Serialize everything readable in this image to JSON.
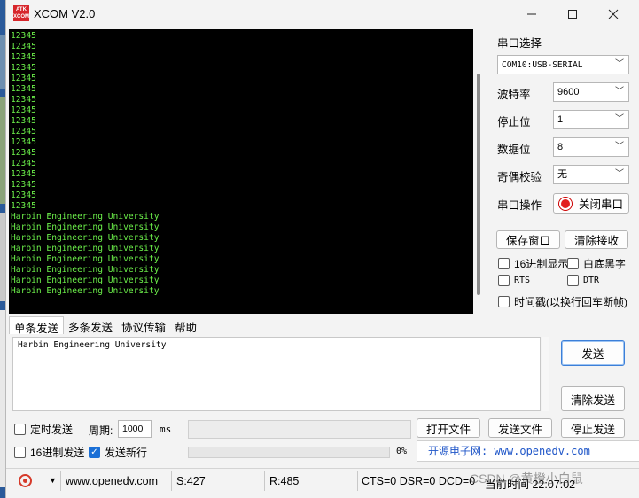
{
  "window": {
    "title": "XCOM V2.0",
    "icon_label": "ATK XCOM"
  },
  "receive": {
    "lines": [
      "12345",
      "12345",
      "12345",
      "12345",
      "12345",
      "12345",
      "12345",
      "12345",
      "12345",
      "12345",
      "12345",
      "12345",
      "12345",
      "12345",
      "12345",
      "12345",
      "12345",
      "Harbin Engineering University",
      "Harbin Engineering University",
      "Harbin Engineering University",
      "Harbin Engineering University",
      "Harbin Engineering University",
      "Harbin Engineering University",
      "Harbin Engineering University",
      "Harbin Engineering University"
    ]
  },
  "settings": {
    "port_select_label": "串口选择",
    "port_value": "COM10:USB-SERIAL",
    "baud_label": "波特率",
    "baud_value": "9600",
    "stop_label": "停止位",
    "stop_value": "1",
    "data_label": "数据位",
    "data_value": "8",
    "parity_label": "奇偶校验",
    "parity_value": "无",
    "port_op_label": "串口操作",
    "close_port_button": "关闭串口",
    "save_window_button": "保存窗口",
    "clear_receive_button": "清除接收",
    "hex_display": "16进制显示",
    "white_bg": "白底黑字",
    "rts": "RTS",
    "dtr": "DTR",
    "timestamp": "时间戳(以换行回车断帧)"
  },
  "tabs": [
    "单条发送",
    "多条发送",
    "协议传输",
    "帮助"
  ],
  "send": {
    "text": "Harbin Engineering University",
    "send_button": "发送",
    "clear_send_button": "清除发送",
    "timed_send": "定时发送",
    "period_label": "周期:",
    "period_value": "1000",
    "period_unit": "ms",
    "open_file_button": "打开文件",
    "send_file_button": "发送文件",
    "stop_send_button": "停止发送",
    "hex_send": "16进制发送",
    "send_newline": "发送新行",
    "progress_text": "0%",
    "progress": 0,
    "link_text": "开源电子网: www.openedv.com"
  },
  "status": {
    "website": "www.openedv.com",
    "sent": "S:427",
    "received": "R:485",
    "lines": "CTS=0 DSR=0 DCD=0",
    "time": "当前时间 22:07:02",
    "watermark": "CSDN @黄橙小白鼠"
  },
  "colors": {
    "terminal_bg": "#000000",
    "terminal_text": "#6cf04a",
    "link": "#1f56c8",
    "led": "#e21f1f"
  }
}
